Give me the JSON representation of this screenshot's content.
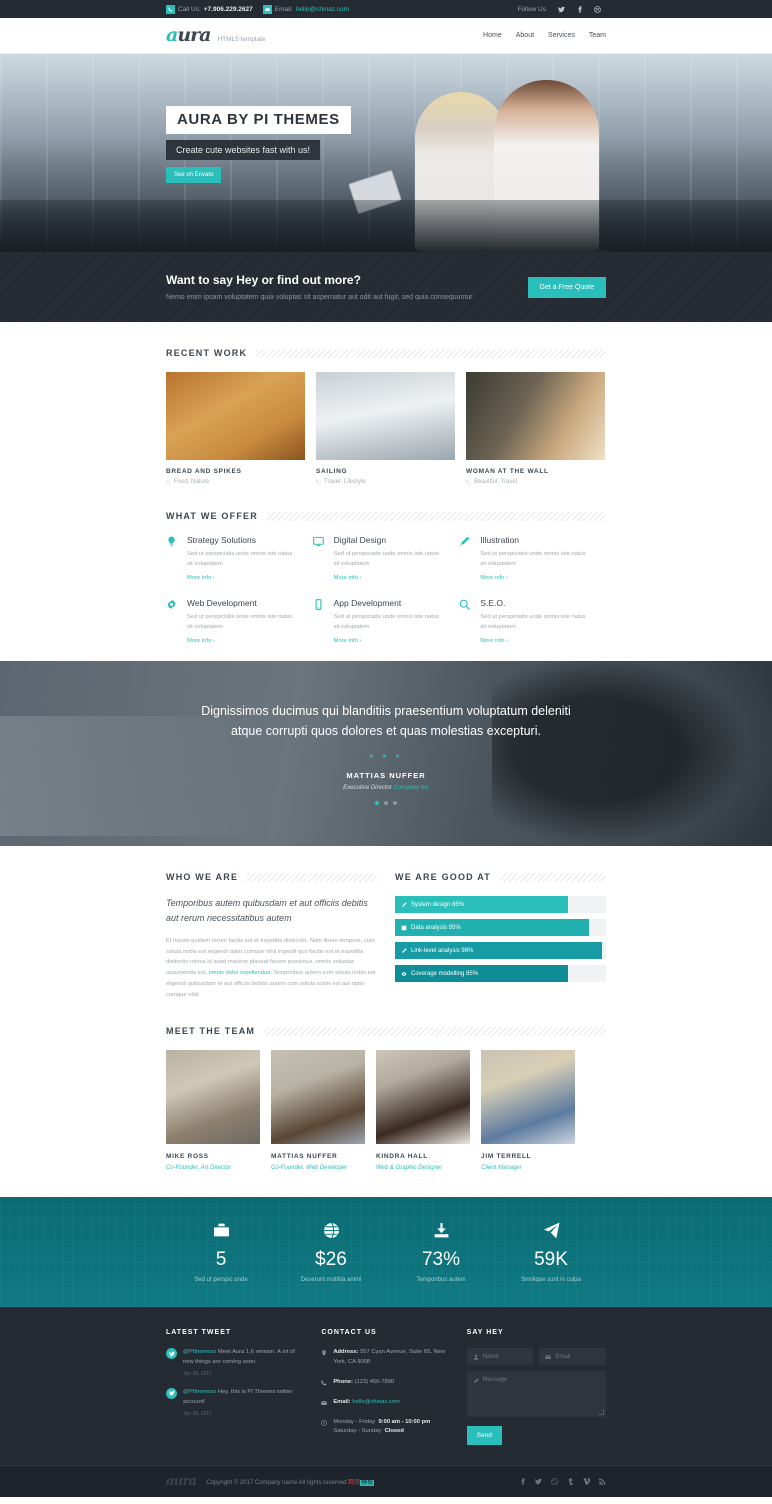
{
  "topbar": {
    "call_label": "Call Us:",
    "phone": "+7.906.229.2627",
    "email_label": "Email:",
    "email": "hello@chinaz.com",
    "follow_label": "Follow Us",
    "socials": [
      "twitter-icon",
      "facebook-icon",
      "dribbble-icon"
    ]
  },
  "brand": {
    "logo_accent": "a",
    "logo_rest": "ura",
    "tagline": "HTML5 template"
  },
  "nav": {
    "items": [
      {
        "label": "Home"
      },
      {
        "label": "About"
      },
      {
        "label": "Services"
      },
      {
        "label": "Team"
      }
    ]
  },
  "hero": {
    "title": "AURA BY PI THEMES",
    "subtitle": "Create cute websites fast with us!",
    "button": "See on Envato"
  },
  "cta": {
    "heading": "Want to say Hey or find out more?",
    "text": "Nemo enim ipsam voluptatem quia voluptas sit aspernatur aut odit aut fugit, sed quia consequuntur",
    "button": "Get a Free Quote"
  },
  "work": {
    "heading": "RECENT WORK",
    "items": [
      {
        "title": "BREAD AND SPIKES",
        "cats": "Food, Nature"
      },
      {
        "title": "SAILING",
        "cats": "Travel, Lifestyle"
      },
      {
        "title": "WOMAN AT THE WALL",
        "cats": "Beautiful, Travel"
      }
    ]
  },
  "services": {
    "heading": "WHAT WE OFFER",
    "more_label": "More info",
    "items": [
      {
        "icon": "lightbulb-icon",
        "title": "Strategy Solutions",
        "text": "Sed ut perspiciatis unde omnis iste natus sit voluptatem"
      },
      {
        "icon": "monitor-icon",
        "title": "Digital Design",
        "text": "Sed ut perspiciatis unde omnis iste natus sit voluptatem"
      },
      {
        "icon": "pencil-icon",
        "title": "Illustration",
        "text": "Sed ut perspiciatis unde omnis iste natus sit voluptatem"
      },
      {
        "icon": "gear-icon",
        "title": "Web Development",
        "text": "Sed ut perspiciatis unde omnis iste natus sit voluptatem"
      },
      {
        "icon": "mobile-icon",
        "title": "App Development",
        "text": "Sed ut perspiciatis unde omnis iste natus sit voluptatem"
      },
      {
        "icon": "search-icon",
        "title": "S.E.O.",
        "text": "Sed ut perspiciatis unde omnis iste natus sit voluptatem"
      }
    ]
  },
  "testimonial": {
    "quote": "Dignissimos ducimus qui blanditiis praesentium voluptatum deleniti atque corrupti quos dolores et quas molestias excepturi.",
    "stars": "★ ★ ★",
    "name": "MATTIAS NUFFER",
    "role": "Executive Director",
    "company": "Company Inc"
  },
  "about": {
    "heading": "WHO WE ARE",
    "lead": "Temporibus autem quibusdam et aut officiis debitis aut rerum necessitatibus autem",
    "body_1": "Et harum quidem rerum facilis est et expedita distinctio. Nam libero tempore, cum soluta nobis est eligendi optio cumque nihil impedit quo facilis est et expedita distinctio minus id quod maxime placeat facere possimus, omnis voluptas assumenda est, ",
    "body_link": "omnis dolor repellendus",
    "body_2": ". Temporibus autem cum soluta nobis est eligendi quibusdam et aut officiis debitis autem cum soluta nobis est aut optio cumque nihil."
  },
  "skills": {
    "heading": "WE ARE GOOD AT",
    "items": [
      {
        "icon": "pencil-icon",
        "label": "System design 85%",
        "value": 85,
        "width_pct": 82,
        "color": "#2bbfbb"
      },
      {
        "icon": "chart-icon",
        "label": "Data analysis 95%",
        "value": 95,
        "width_pct": 92,
        "color": "#21b2b0"
      },
      {
        "icon": "pencil-icon",
        "label": "Link-level analysis 98%",
        "value": 98,
        "width_pct": 98,
        "color": "#179ba4"
      },
      {
        "icon": "eye-icon",
        "label": "Coverage modelling 85%",
        "value": 85,
        "width_pct": 82,
        "color": "#0f8d97"
      }
    ]
  },
  "team": {
    "heading": "MEET THE TEAM",
    "members": [
      {
        "name": "MIKE ROSS",
        "role": "Co-Founder, Art Director"
      },
      {
        "name": "MATTIAS NUFFER",
        "role": "Co-Founder, Web Developer"
      },
      {
        "name": "KINDRA HALL",
        "role": "Web & Graphic Designer"
      },
      {
        "name": "JIM TERRELL",
        "role": "Client Manager"
      }
    ]
  },
  "stats": {
    "items": [
      {
        "icon": "briefcase-icon",
        "value": "5",
        "caption": "Sed ut perspic unde"
      },
      {
        "icon": "globe-icon",
        "value": "$26",
        "caption": "Deserunt mollitia animi"
      },
      {
        "icon": "download-icon",
        "value": "73%",
        "caption": "Temporibus autem"
      },
      {
        "icon": "paper-plane-icon",
        "value": "59K",
        "caption": "Similique sunt in culpa"
      }
    ]
  },
  "footer": {
    "tweet": {
      "title": "LATEST TWEET",
      "items": [
        {
          "handle": "@PIthemess",
          "text": " Meet Aura 1.6 version. A lot of new things are coming soon.",
          "date": "Jun 28, 2017"
        },
        {
          "handle": "@PIthemess",
          "text": " Hey, this is PI Themes twitter account!",
          "date": "Jun 28, 2017"
        }
      ]
    },
    "contact": {
      "title": "CONTACT US",
      "address_label": "Address:",
      "address": " 557 Cyan Avenue, Suite 65, New York, CA 9008",
      "phone_label": "Phone:",
      "phone": " (123) 456-7890",
      "email_label": "Email:",
      "email": "hello@chinaz.com",
      "hours_weekday_label": "Monday - Friday",
      "hours_weekday": "9:00 am - 10:00 pm",
      "hours_weekend_label": "Saturday - Sunday",
      "hours_weekend": "Closed"
    },
    "form": {
      "title": "SAY HEY",
      "name_placeholder": "Name",
      "email_placeholder": "Email",
      "message_placeholder": "Message",
      "send_label": "Send"
    }
  },
  "copyright": {
    "logo": "aura",
    "text": "Copyright © 2017 Company name All rights reserved.",
    "cn_text": "网页",
    "hl_text": "模板",
    "socials": [
      "facebook-icon",
      "twitter-icon",
      "dribbble-icon",
      "tumblr-icon",
      "vimeo-icon",
      "rss-icon"
    ]
  },
  "colors": {
    "accent": "#2bbfbb",
    "dark": "#252b33",
    "teal_deep": "#0e7b84"
  }
}
